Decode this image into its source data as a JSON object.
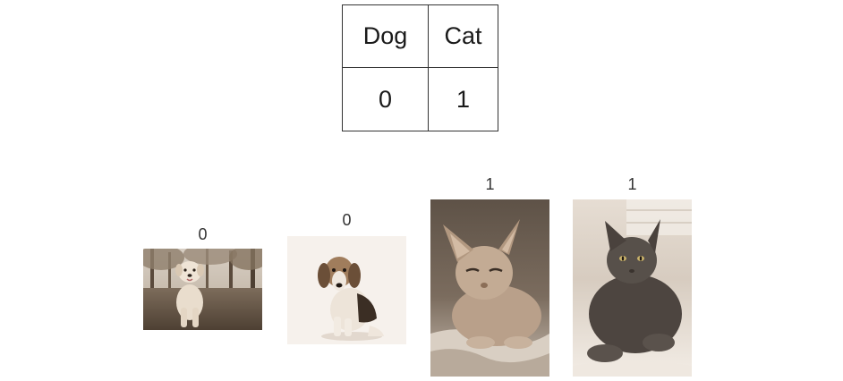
{
  "encoding_table": {
    "headers": [
      "Dog",
      "Cat"
    ],
    "values": [
      "0",
      "1"
    ]
  },
  "images": [
    {
      "label": "0",
      "depicts": "dog-puppy"
    },
    {
      "label": "0",
      "depicts": "dog-beagle"
    },
    {
      "label": "1",
      "depicts": "cat-sphynx"
    },
    {
      "label": "1",
      "depicts": "cat-gray"
    }
  ],
  "colors": {
    "sepia_light": "#efe6dc",
    "sepia_mid": "#a08a72",
    "sepia_dark": "#4a3c30",
    "border": "#333333"
  }
}
